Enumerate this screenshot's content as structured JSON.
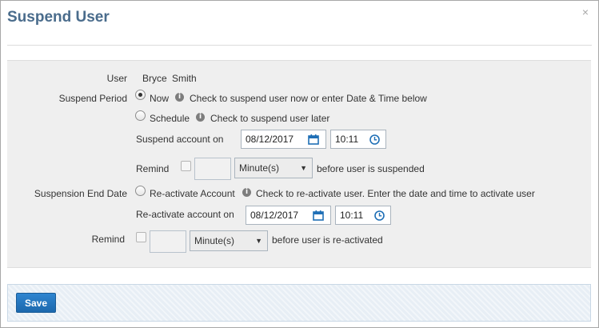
{
  "dialog": {
    "title": "Suspend User",
    "close_glyph": "×"
  },
  "user": {
    "label": "User",
    "first_name": "Bryce",
    "last_name": "Smith"
  },
  "suspend_period": {
    "label": "Suspend Period",
    "now_label": "Now",
    "now_hint": "Check to suspend user now or enter Date & Time below",
    "schedule_label": "Schedule",
    "schedule_hint": "Check to suspend user later",
    "account_on_label": "Suspend account on",
    "date": "08/12/2017",
    "time": "10:11",
    "remind_label": "Remind",
    "remind_value": "",
    "remind_unit": "Minute(s)",
    "remind_suffix": "before user is suspended"
  },
  "suspension_end": {
    "label": "Suspension End Date",
    "reactivate_label": "Re-activate Account",
    "reactivate_hint": "Check to re-activate user. Enter the date and time to activate user",
    "account_on_label": "Re-activate account on",
    "date": "08/12/2017",
    "time": "10:11",
    "remind_label": "Remind",
    "remind_value": "",
    "remind_unit": "Minute(s)",
    "remind_suffix": "before user is re-activated"
  },
  "footer": {
    "save_label": "Save"
  },
  "colors": {
    "title": "#4a6c8c",
    "icon_blue": "#1f6fb6",
    "save_button": "#2277c2",
    "panel_bg": "#efefef"
  },
  "icons": {
    "info": "info-icon",
    "calendar": "calendar-icon",
    "clock": "clock-icon",
    "dropdown": "chevron-down-icon",
    "close": "close-icon"
  }
}
